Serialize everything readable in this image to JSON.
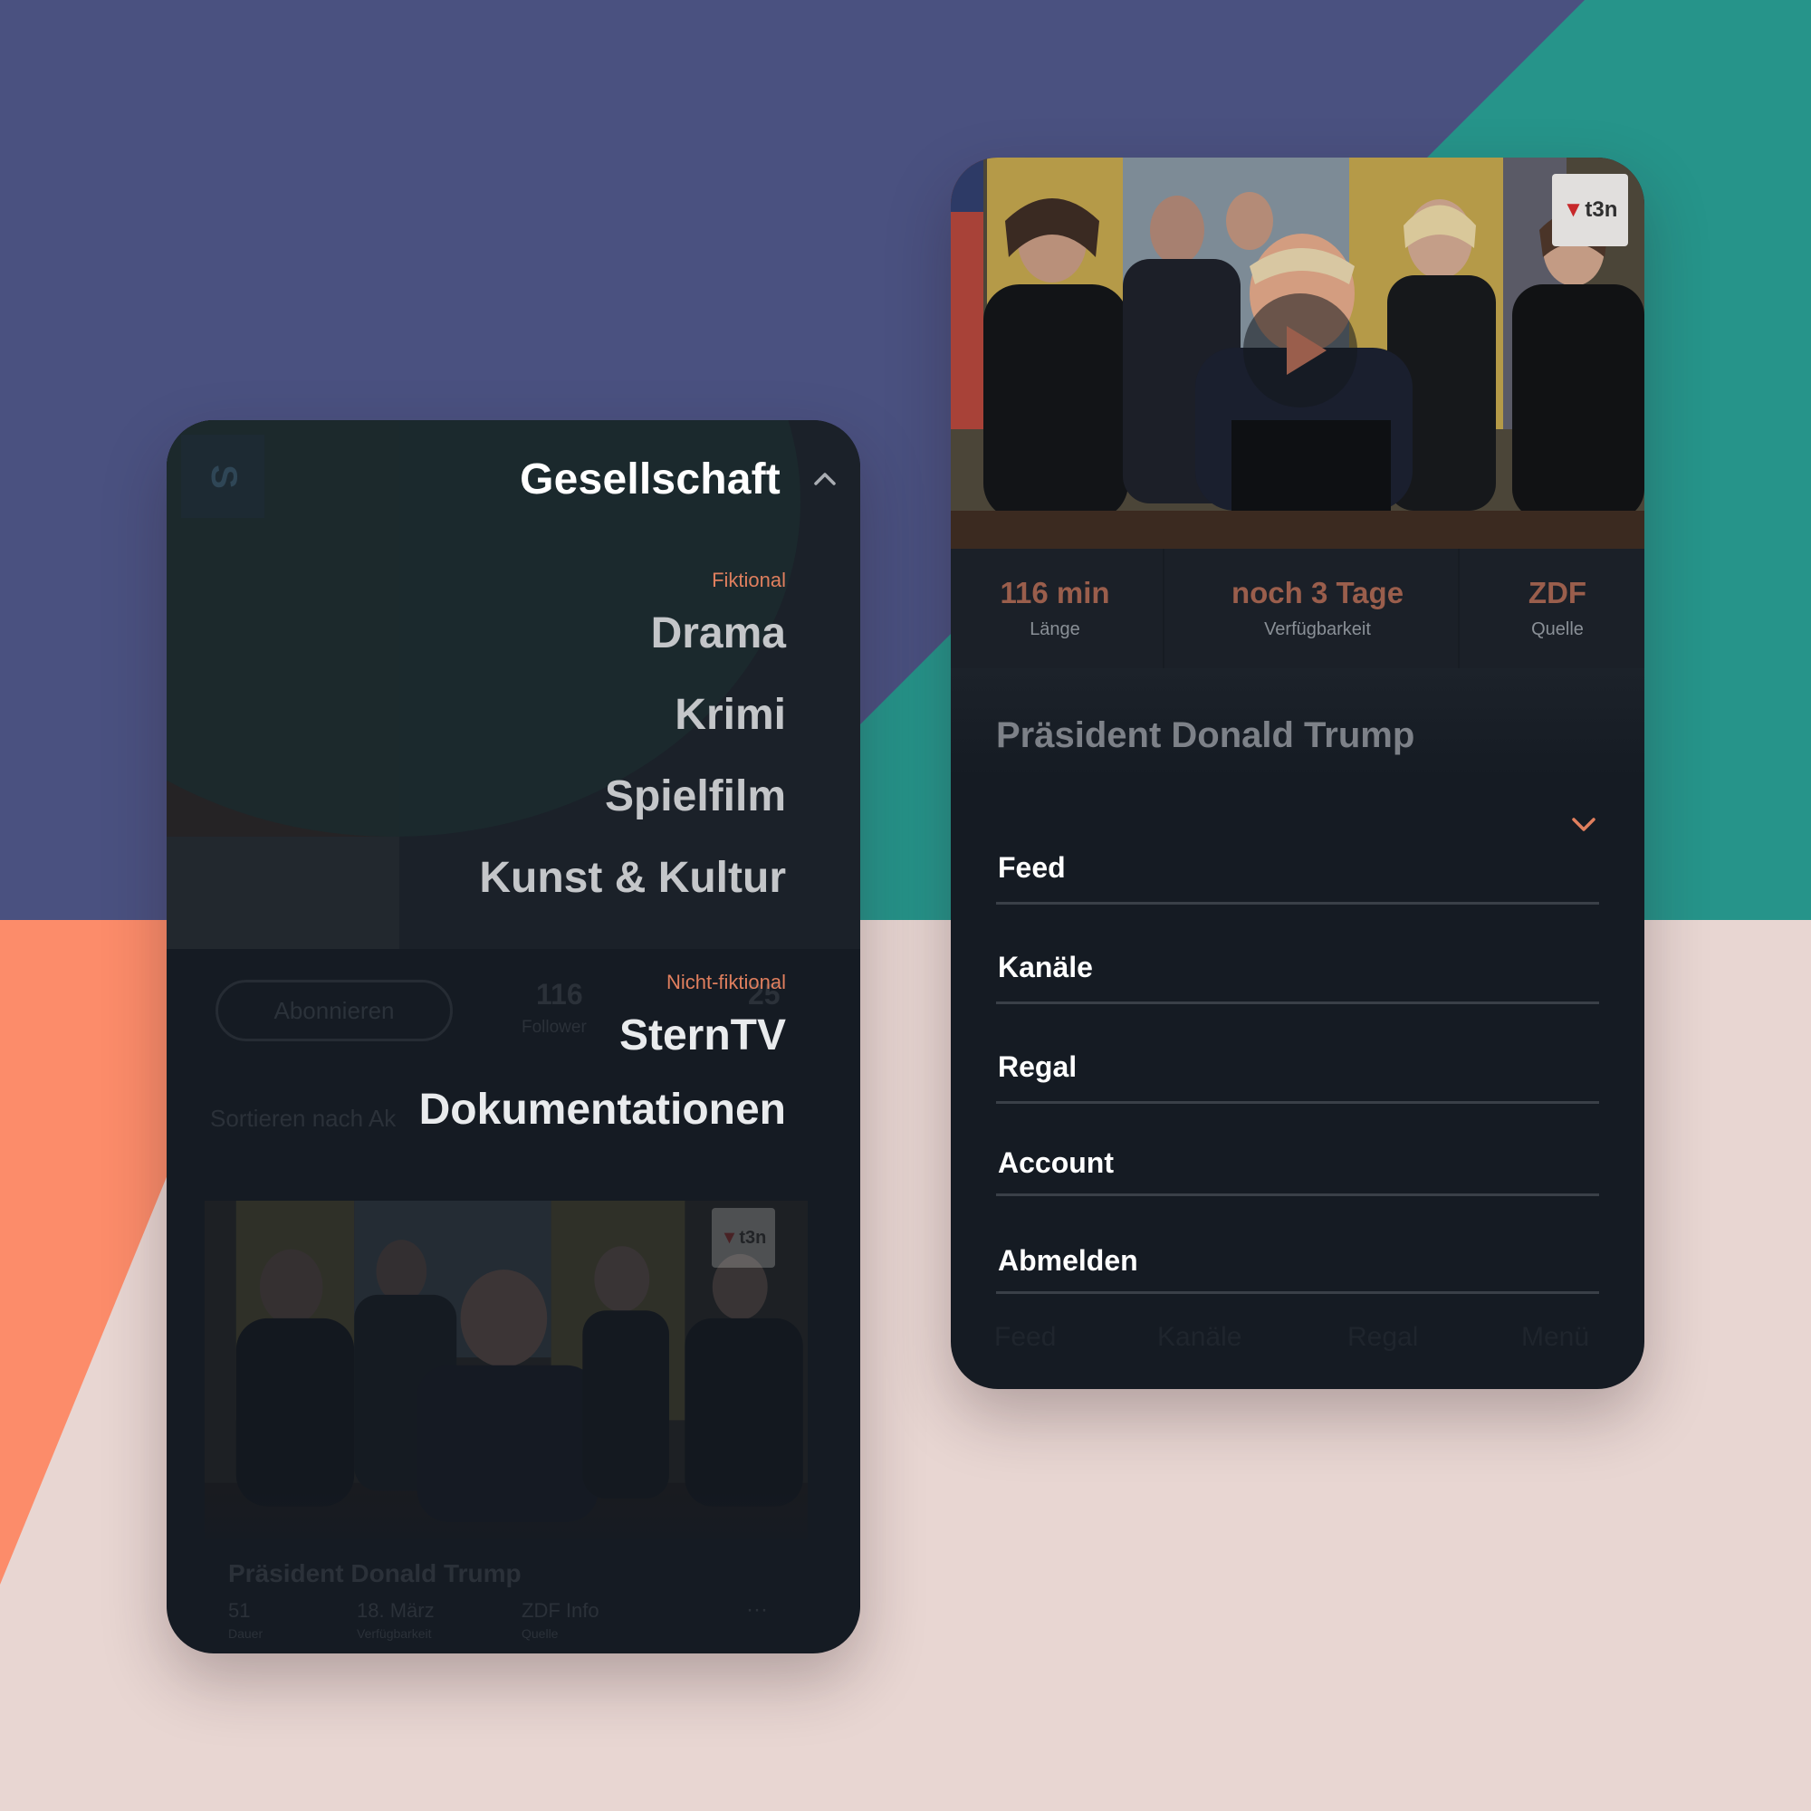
{
  "colors": {
    "indigo": "#4a5180",
    "teal": "#26948a",
    "coral": "#fc8c6a",
    "blush": "#e8d6d2",
    "card": "#151b23",
    "accent": "#e07f5e"
  },
  "left_panel": {
    "logo_letter": "S",
    "menu": {
      "title": "Gesellschaft",
      "toggle_icon": "chevron-up-icon",
      "sections": [
        {
          "label": "Fiktional",
          "items": [
            "Drama",
            "Krimi",
            "Spielfilm",
            "Kunst & Kultur"
          ]
        },
        {
          "label": "Nicht-fiktional",
          "items": [
            "SternTV",
            "Dokumentationen"
          ]
        }
      ]
    },
    "background_profile": {
      "subscribe_label": "Abonnieren",
      "follower_count": "116",
      "follower_label": "Follower",
      "second_count": "25",
      "sort_label": "Sortieren nach Ak",
      "card": {
        "badge": "t3n",
        "title": "Präsident Donald Trump",
        "meta": [
          {
            "value": "51",
            "label": "Dauer"
          },
          {
            "value": "18. März",
            "label": "Verfügbarkeit"
          },
          {
            "value": "ZDF Info",
            "label": "Quelle"
          }
        ],
        "more": "···"
      }
    }
  },
  "right_panel": {
    "badge": "t3n",
    "play_icon": "play-icon",
    "stats": [
      {
        "value": "116 min",
        "label": "Länge"
      },
      {
        "value": "noch 3 Tage",
        "label": "Verfügbarkeit"
      },
      {
        "value": "ZDF",
        "label": "Quelle"
      }
    ],
    "title": "Präsident Donald Trump",
    "collapse_icon": "chevron-down-icon",
    "nav_items": [
      "Feed",
      "Kanäle",
      "Regal",
      "Account",
      "Abmelden"
    ],
    "tab_bar": [
      "Feed",
      "Kanäle",
      "Regal",
      "Menü"
    ]
  }
}
